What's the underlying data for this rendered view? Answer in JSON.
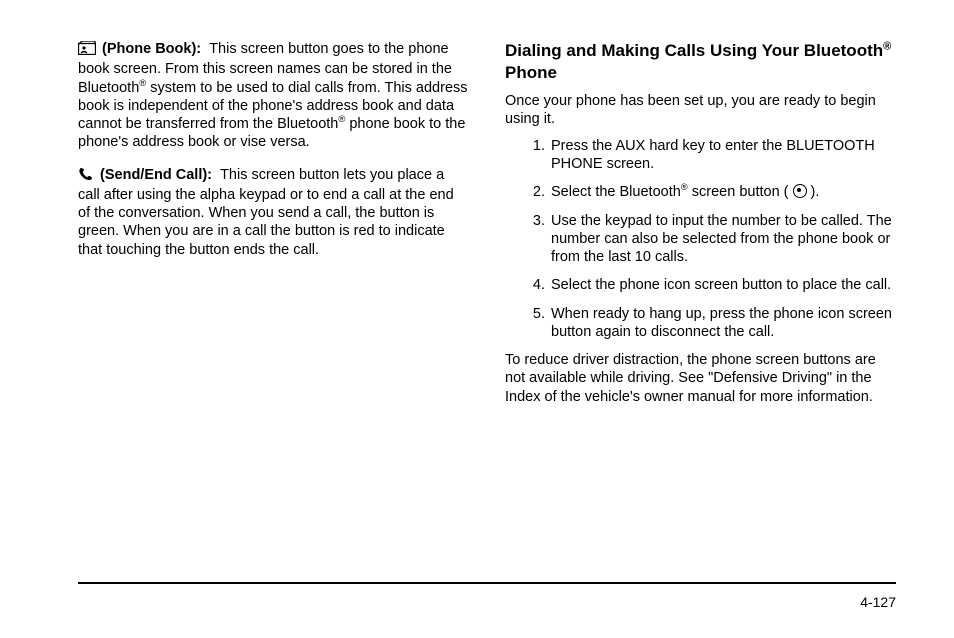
{
  "left_column": {
    "phone_book": {
      "label": "(Phone Book):",
      "text_before_sup1": "This screen button goes to the phone book screen. From this screen names can be stored in the Bluetooth",
      "sup1": "®",
      "text_mid": " system to be used to dial calls from. This address book is independent of the phone's address book and data cannot be transferred from the Bluetooth",
      "sup2": "®",
      "text_after": " phone book to the phone's address book or vise versa."
    },
    "send_end": {
      "label": "(Send/End Call):",
      "text": "This screen button lets you place a call after using the alpha keypad or to end a call at the end of the conversation. When you send a call, the button is green. When you are in a call the button is red to indicate that touching the button ends the call."
    }
  },
  "right_column": {
    "heading_part1": "Dialing and Making Calls Using Your Bluetooth",
    "heading_sup": "®",
    "heading_part2": " Phone",
    "intro": "Once your phone has been set up, you are ready to begin using it.",
    "steps": [
      "Press the AUX hard key to enter the BLUETOOTH PHONE screen.",
      "",
      "Use the keypad to input the number to be called. The number can also be selected from the phone book or from the last 10 calls.",
      "Select the phone icon screen button to place the call.",
      "When ready to hang up, press the phone icon screen button again to disconnect the call."
    ],
    "step2_before": "Select the Bluetooth",
    "step2_sup": "®",
    "step2_after": " screen button ( ",
    "step2_close": " ).",
    "closing": "To reduce driver distraction, the phone screen buttons are not available while driving. See \"Defensive Driving\" in the Index of the vehicle's owner manual for more information."
  },
  "page_number": "4-127"
}
